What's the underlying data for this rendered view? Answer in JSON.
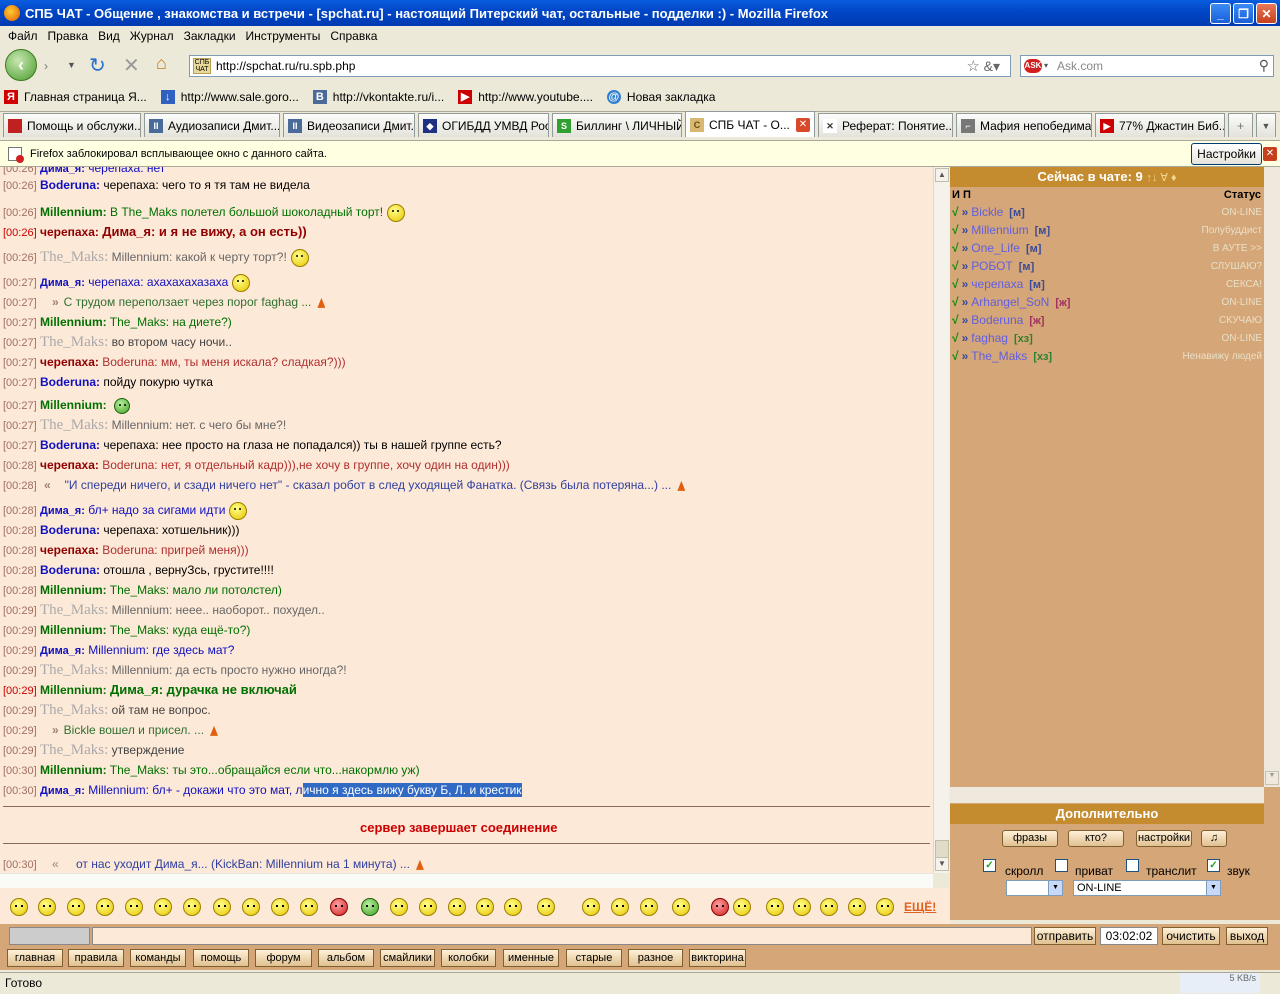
{
  "window": {
    "title": "СПБ ЧАТ - Общение , знакомства и встречи - [spchat.ru] - настоящий Питерский чат, остальные - подделки :) - Mozilla Firefox",
    "minimize": "_",
    "maximize": "❐",
    "close": "✕"
  },
  "menu": [
    "Файл",
    "Правка",
    "Вид",
    "Журнал",
    "Закладки",
    "Инструменты",
    "Справка"
  ],
  "url": "http://spchat.ru/ru.spb.php",
  "url_favicon": "СПБ ЧАТ",
  "search_placeholder": "Ask.com",
  "bookmarks": [
    {
      "label": "Главная страница Я...",
      "color": "#d00000",
      "glyph": "Я"
    },
    {
      "label": "http://www.sale.goro...",
      "color": "#3060c0",
      "glyph": "↓"
    },
    {
      "label": "http://vkontakte.ru/i...",
      "color": "#4a6a9a",
      "glyph": "B"
    },
    {
      "label": "http://www.youtube....",
      "color": "#cc0000",
      "glyph": "▶"
    },
    {
      "label": "Новая закладка",
      "color": "#3080d0",
      "glyph": "@"
    }
  ],
  "tabs": [
    {
      "label": "Помощь и обслужи...",
      "color": "#c02020",
      "glyph": "▮"
    },
    {
      "label": "Аудиозаписи Дмит...",
      "color": "#4a6a9a",
      "glyph": "II"
    },
    {
      "label": "Видеозаписи Дмит...",
      "color": "#4a6a9a",
      "glyph": "II"
    },
    {
      "label": "ОГИБДД УМВД Рос...",
      "color": "#203080",
      "glyph": "◆"
    },
    {
      "label": "Биллинг \\ ЛИЧНЫЙ...",
      "color": "#30a030",
      "glyph": "S"
    },
    {
      "label": "СПБ ЧАТ - О...",
      "color": "#d8b870",
      "glyph": "С",
      "active": true
    },
    {
      "label": "Реферат: Понятие...",
      "color": "#333",
      "glyph": "✕"
    },
    {
      "label": "Мафия непобедима",
      "color": "#777",
      "glyph": "⌐"
    },
    {
      "label": "77% Джастин Биб...",
      "color": "#cc0000",
      "glyph": "▶"
    }
  ],
  "notification": {
    "text": "Firefox заблокировал всплывающее окно с данного сайта.",
    "button": "Настройки"
  },
  "messages": [
    {
      "time": "[00:26]",
      "nick": "Boderuna:",
      "nick_color": "#1010c0",
      "text": "черепаха: чего то я тя там не видела",
      "text_color": "#000"
    },
    {
      "time": "[00:26]",
      "nick": "Millennium:",
      "nick_color": "#007000",
      "text": "В The_Maks полетел большой шоколадный торт!",
      "text_color": "#007000",
      "smile": true
    },
    {
      "time": "[00:26]",
      "time_red": true,
      "nick": "черепаха:",
      "nick_color": "#900000",
      "text": "Дима_я: и я не вижу, а он есть))",
      "text_color": "#900000",
      "bold": true
    },
    {
      "time": "[00:26]",
      "nick": "The_Maks:",
      "nick_color": "#aaa",
      "nick_serif": true,
      "text": "Millennium: какой к черту торт?!",
      "text_color": "#666",
      "smile": true
    },
    {
      "time": "[00:27]",
      "nick": "Дима_я:",
      "nick_color": "#1010c0",
      "nick_small": true,
      "text": "черепаха: ахахахахазаха",
      "text_color": "#1010c0",
      "smile": true
    },
    {
      "time": "[00:27]",
      "prefix": "»",
      "text": "С трудом переползает через порог faghag ...",
      "text_color": "#307030",
      "cone": true,
      "indent": true
    },
    {
      "time": "[00:27]",
      "nick": "Millennium:",
      "nick_color": "#007000",
      "text": "The_Maks: на диете?)",
      "text_color": "#007000"
    },
    {
      "time": "[00:27]",
      "nick": "The_Maks:",
      "nick_color": "#aaa",
      "nick_serif": true,
      "text": "во втором часу ночи..",
      "text_color": "#444"
    },
    {
      "time": "[00:27]",
      "nick": "черепаха:",
      "nick_color": "#900000",
      "text": "Boderuna: мм, ты меня искала? сладкая?)))",
      "text_color": "#b03030"
    },
    {
      "time": "[00:27]",
      "nick": "Boderuna:",
      "nick_color": "#1010c0",
      "text": "пойду покурю чутка",
      "text_color": "#000"
    },
    {
      "time": "[00:27]",
      "nick": "Millennium:",
      "nick_color": "#007000",
      "text": "",
      "text_color": "#007000",
      "smile_green": true
    },
    {
      "time": "[00:27]",
      "nick": "The_Maks:",
      "nick_color": "#aaa",
      "nick_serif": true,
      "text": "Millennium: нет. с чего бы мне?!",
      "text_color": "#666"
    },
    {
      "time": "[00:27]",
      "nick": "Boderuna:",
      "nick_color": "#1010c0",
      "text": "черепаха: нее просто на глаза не попадался)) ты в нашей группе есть?",
      "text_color": "#000"
    },
    {
      "time": "[00:28]",
      "nick": "черепаха:",
      "nick_color": "#900000",
      "text": "Boderuna: нет, я отдельный кадр))),не хочу в группе, хочу один на один)))",
      "text_color": "#b03030"
    },
    {
      "time": "[00:28]",
      "prefix": "«",
      "text": "\"И спереди ничего, и сзади ничего нет\" - сказал робот в след уходящей Фанатка. (Связь была потеряна...) ...",
      "text_color": "#3040a0",
      "cone": true,
      "indent": true
    },
    {
      "time": "[00:28]",
      "nick": "Дима_я:",
      "nick_color": "#1010c0",
      "nick_small": true,
      "text": "бл+ надо за сигами идти",
      "text_color": "#1010c0",
      "smile": true
    },
    {
      "time": "[00:28]",
      "nick": "Boderuna:",
      "nick_color": "#1010c0",
      "text": "черепаха: хотшельник)))",
      "text_color": "#000"
    },
    {
      "time": "[00:28]",
      "nick": "черепаха:",
      "nick_color": "#900000",
      "text": "Boderuna: пригрей меня)))",
      "text_color": "#b03030"
    },
    {
      "time": "[00:28]",
      "nick": "Boderuna:",
      "nick_color": "#1010c0",
      "text": "отошла , вернуЗсь, грустите!!!!",
      "text_color": "#000"
    },
    {
      "time": "[00:28]",
      "nick": "Millennium:",
      "nick_color": "#007000",
      "text": "The_Maks: мало ли потолстел)",
      "text_color": "#007000"
    },
    {
      "time": "[00:29]",
      "nick": "The_Maks:",
      "nick_color": "#aaa",
      "nick_serif": true,
      "text": "Millennium: неее.. наоборот.. похудел..",
      "text_color": "#666"
    },
    {
      "time": "[00:29]",
      "nick": "Millennium:",
      "nick_color": "#007000",
      "text": "The_Maks: куда ещё-то?)",
      "text_color": "#007000"
    },
    {
      "time": "[00:29]",
      "nick": "Дима_я:",
      "nick_color": "#1010c0",
      "nick_small": true,
      "text": "Millennium: где здесь мат?",
      "text_color": "#1010c0"
    },
    {
      "time": "[00:29]",
      "nick": "The_Maks:",
      "nick_color": "#aaa",
      "nick_serif": true,
      "text": "Millennium: да есть просто нужно иногда?!",
      "text_color": "#666"
    },
    {
      "time": "[00:29]",
      "time_red": true,
      "nick": "Millennium:",
      "nick_color": "#007000",
      "text": "Дима_я: дурачка не включай",
      "text_color": "#007000",
      "bold": true
    },
    {
      "time": "[00:29]",
      "nick": "The_Maks:",
      "nick_color": "#aaa",
      "nick_serif": true,
      "text": "ой там не вопрос.",
      "text_color": "#444"
    },
    {
      "time": "[00:29]",
      "prefix": "»",
      "text": "Bickle вошел и присел. ...",
      "text_color": "#307030",
      "cone": true,
      "indent": true
    },
    {
      "time": "[00:29]",
      "nick": "The_Maks:",
      "nick_color": "#aaa",
      "nick_serif": true,
      "text": "утверждение",
      "text_color": "#444"
    },
    {
      "time": "[00:30]",
      "nick": "Millennium:",
      "nick_color": "#007000",
      "text": "The_Maks: ты это...обращайся если что...накормлю уж)",
      "text_color": "#007000"
    },
    {
      "time": "[00:30]",
      "nick": "Дима_я:",
      "nick_color": "#1010c0",
      "nick_small": true,
      "text": "Millennium: бл+ - докажи что это мат, л",
      "sel": "ично я здесь вижу букву Б, Л. и крестик",
      "text_color": "#1010c0"
    }
  ],
  "server_msg": "сервер завершает соединение",
  "last_msg": {
    "time": "[00:30]",
    "prefix": "«",
    "text": "от нас уходит Дима_я... (KickBan: Millennium на 1 минута) ..."
  },
  "online": {
    "title": "Сейчас в чате: 9",
    "arrows": "↑↓ ∀ ♦",
    "col_ip": "И П",
    "col_status": "Статус",
    "users": [
      {
        "name": "Bickle",
        "gender": "[м]",
        "gcolor": "#3a4a9a",
        "status": "ON-LINE"
      },
      {
        "name": "Millennium",
        "gender": "[м]",
        "gcolor": "#3a4a9a",
        "status": "Полубуддист"
      },
      {
        "name": "One_Life",
        "gender": "[м]",
        "gcolor": "#3a4a9a",
        "status": "В АУТЕ >>"
      },
      {
        "name": "РОБОТ",
        "gender": "[м]",
        "gcolor": "#3a4a9a",
        "status": "СЛУШАЮ?"
      },
      {
        "name": "черепаха",
        "gender": "[м]",
        "gcolor": "#3a4a9a",
        "status": "СЕКСА!"
      },
      {
        "name": "Arhangel_SoN",
        "gender": "[ж]",
        "gcolor": "#a03060",
        "status": "ON-LINE"
      },
      {
        "name": "Boderuna",
        "gender": "[ж]",
        "gcolor": "#a03060",
        "status": "СКУЧАЮ"
      },
      {
        "name": "faghag",
        "gender": "[хз]",
        "gcolor": "#308030",
        "status": "ON-LINE"
      },
      {
        "name": "The_Maks",
        "gender": "[хз]",
        "gcolor": "#308030",
        "status": "Ненавижу людей"
      }
    ]
  },
  "extra": {
    "title": "Дополнительно",
    "b1": "фразы",
    "b2": "кто?",
    "b3": "настройки",
    "b4": "♫",
    "scroll": "скролл",
    "private": "приват",
    "translit": "транслит",
    "sound": "звук",
    "status_sel": "ON-LINE"
  },
  "more": "ЕЩЁ!",
  "input": {
    "send": "отправить",
    "clock": "03:02:02",
    "clear": "очистить",
    "exit": "выход"
  },
  "nav": [
    "главная",
    "правила",
    "команды",
    "помощь",
    "форум",
    "альбом",
    "смайлики",
    "колобки",
    "именные",
    "старые",
    "разное",
    "викторина"
  ],
  "status": "Готово",
  "speed": "5 KB/s"
}
